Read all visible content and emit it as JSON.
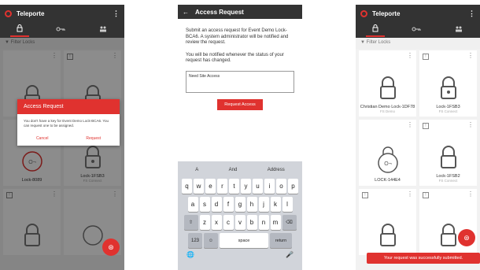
{
  "app": {
    "title": "Teleporte",
    "menu_dots": "⋮"
  },
  "tabs": {
    "locks_icon": "lock-icon",
    "keys_icon": "key-icon",
    "users_icon": "users-icon"
  },
  "filter": {
    "placeholder": "Filter Locks"
  },
  "screen1": {
    "cards": [
      {
        "name": "",
        "sub": ""
      },
      {
        "name": "",
        "sub": ""
      },
      {
        "name": "Lock-8089",
        "sub": ""
      },
      {
        "name": "Lock-1FSB3",
        "sub": "FS Connect"
      },
      {
        "name": "",
        "sub": ""
      },
      {
        "name": "",
        "sub": ""
      }
    ],
    "dialog": {
      "title": "Access Request",
      "body": "You don't have a key for Event Demo Lock-BCA6. You can request one to be assigned.",
      "cancel": "Cancel",
      "request": "Request"
    }
  },
  "screen2": {
    "title": "Access Request",
    "back": "←",
    "para1": "Submit an access request for Event Demo Lock-BCA6. A system administrator will be notified and review the request.",
    "para2": "You will be notified whenever the status of your request has changed.",
    "input_value": "Need Site Access",
    "button": "Request Access",
    "keyboard": {
      "suggestions": [
        "A",
        "And",
        "Address"
      ],
      "row1": [
        "q",
        "w",
        "e",
        "r",
        "t",
        "y",
        "u",
        "i",
        "o",
        "p"
      ],
      "row2": [
        "a",
        "s",
        "d",
        "f",
        "g",
        "h",
        "j",
        "k",
        "l"
      ],
      "row3": [
        "z",
        "x",
        "c",
        "v",
        "b",
        "n",
        "m"
      ],
      "shift": "⇧",
      "delete": "⌫",
      "numbers": "123",
      "emoji": "☺",
      "space": "space",
      "return": "return",
      "globe": "🌐",
      "mic": "🎤"
    }
  },
  "screen3": {
    "cards": [
      {
        "name": "Christian Demo Lock-1DF78",
        "sub": "FS Demo"
      },
      {
        "name": "Lock-1FSB3",
        "sub": "FS Connect"
      },
      {
        "name": "LOCK-144E4",
        "sub": ""
      },
      {
        "name": "Lock-1FSB2",
        "sub": "FS Connect"
      },
      {
        "name": "",
        "sub": ""
      },
      {
        "name": "",
        "sub": ""
      }
    ],
    "toast": "Your request was successfully submitted."
  },
  "colors": {
    "accent": "#e0322f",
    "bar": "#333333"
  }
}
